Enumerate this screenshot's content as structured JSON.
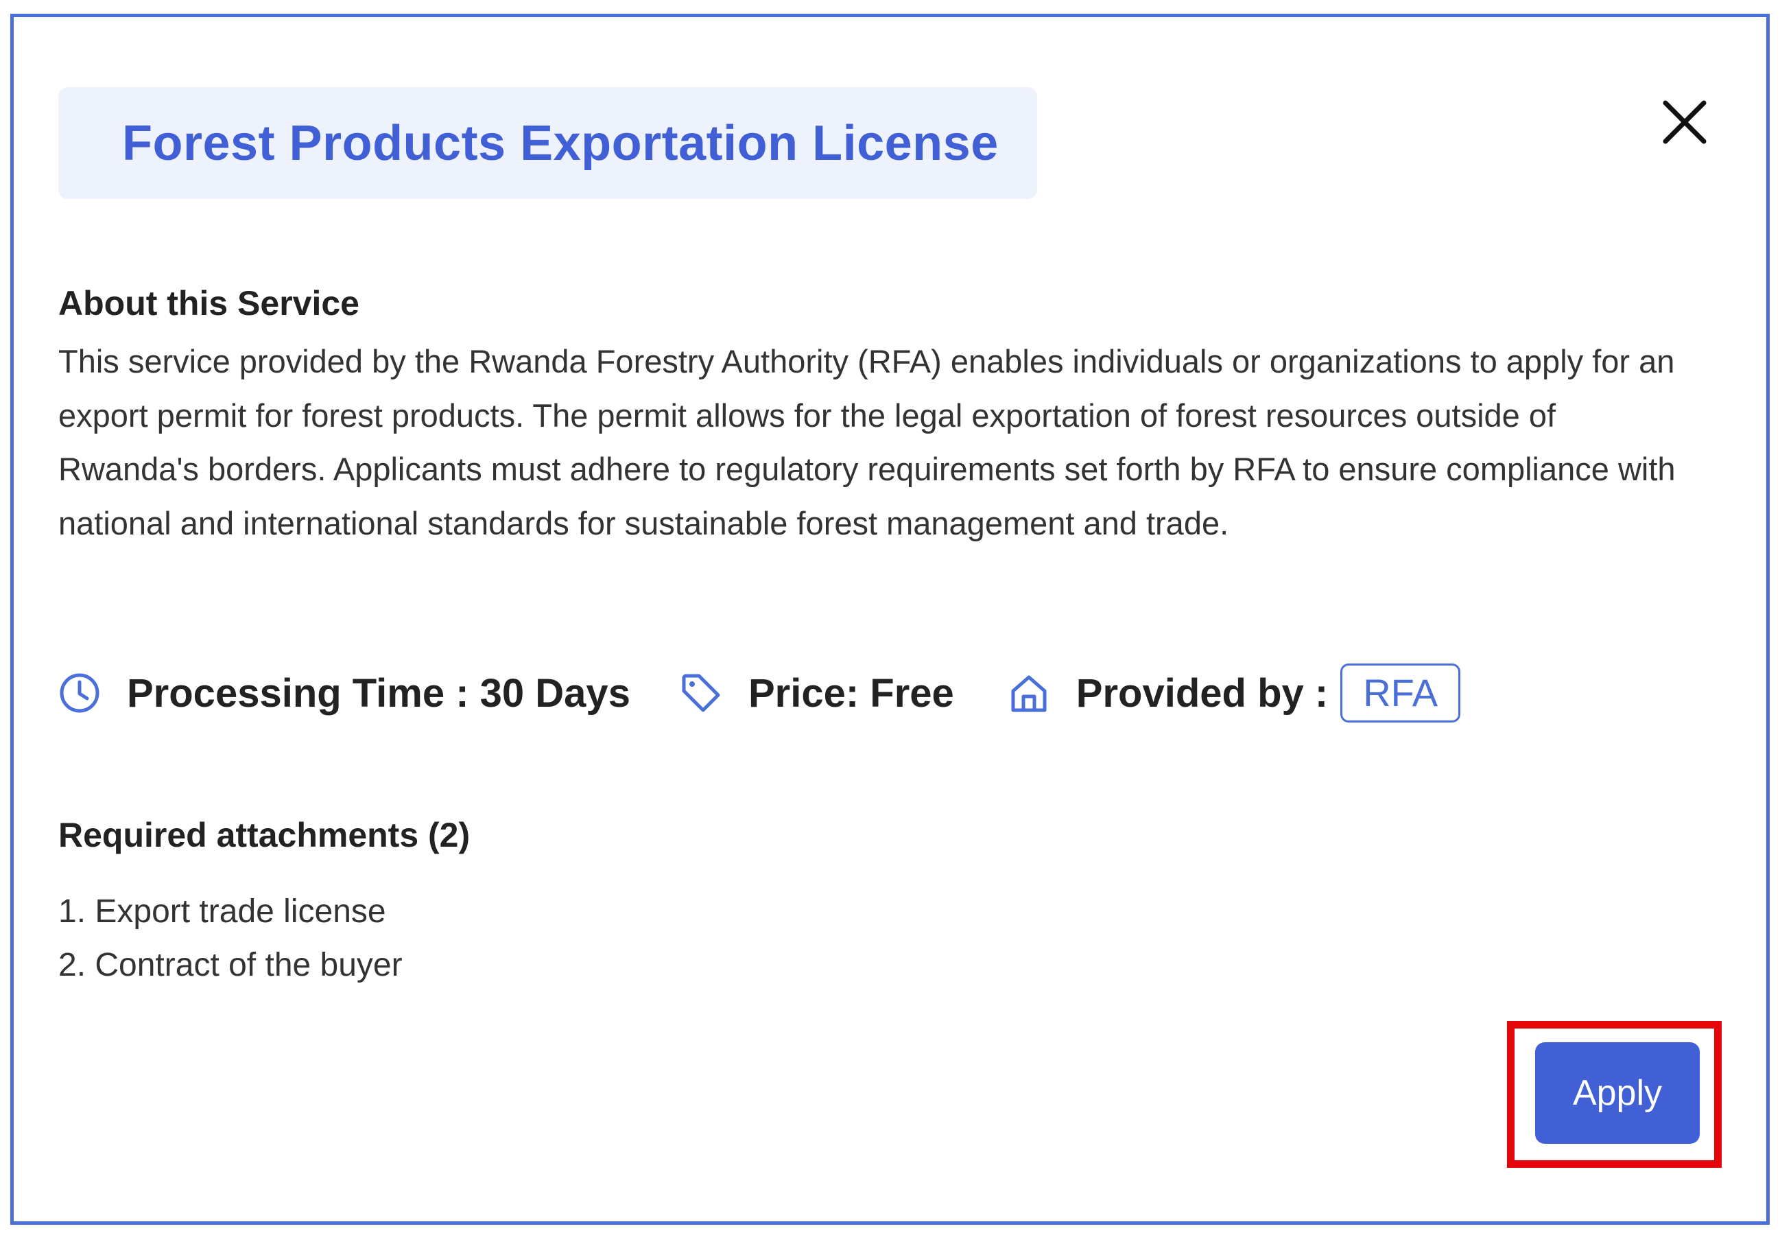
{
  "dialog": {
    "title": "Forest Products Exportation License",
    "close_icon": "close-icon"
  },
  "about": {
    "heading": "About this Service",
    "body": "This service provided by the Rwanda Forestry Authority (RFA) enables individuals or organizations to apply for an export permit for forest products. The permit allows for the legal exportation of forest resources outside of Rwanda's borders. Applicants must adhere to regulatory requirements set forth by RFA to ensure compliance with national and international standards for sustainable forest management and trade."
  },
  "meta": {
    "processing_time": "Processing Time : 30 Days",
    "price": "Price: Free",
    "provided_by_label": "Provided by :",
    "provider": "RFA",
    "icons": [
      "clock-icon",
      "tag-icon",
      "home-icon"
    ]
  },
  "attachments": {
    "heading": "Required attachments (2)",
    "items": [
      "1. Export trade license",
      "2. Contract of the buyer"
    ]
  },
  "actions": {
    "apply_label": "Apply"
  },
  "colors": {
    "accent": "#4160d6",
    "frame_border": "#4a6fd9",
    "title_bg": "#eef2fd",
    "highlight": "#e4060b"
  }
}
